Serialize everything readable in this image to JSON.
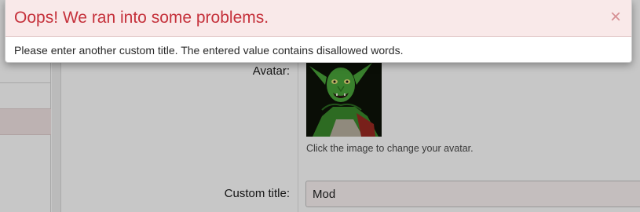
{
  "dialog": {
    "title": "Oops! We ran into some problems.",
    "close_icon": "close-icon",
    "close_glyph": "×",
    "message": "Please enter another custom title. The entered value contains disallowed words."
  },
  "form": {
    "avatar_label": "Avatar:",
    "avatar_hint": "Click the image to change your avatar.",
    "custom_title_label": "Custom title:",
    "custom_title_value": "Mod"
  },
  "colors": {
    "error_title": "#c5313b",
    "error_header_bg": "#f9e9e9",
    "sidebar_active_bg": "#f3e4e4"
  }
}
